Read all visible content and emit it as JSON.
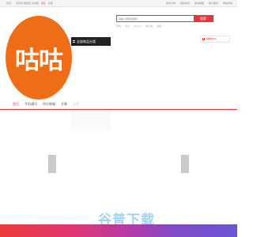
{
  "topbar": {
    "location": "送至：",
    "location_value": "北京市 朝阳区 东城区",
    "login": "您好",
    "register": "注册",
    "links": [
      "我的订单",
      "我的浏览",
      "我的收藏",
      "客户服务",
      "网站导航"
    ]
  },
  "logo": {
    "text": "咕咕",
    "color": "#ed6e17"
  },
  "category_button": {
    "label": "全部商品分类"
  },
  "search": {
    "placeholder": "请输入搜索关键字",
    "button_label": "搜索",
    "hotwords": [
      "手机",
      "牛奶",
      "iphone",
      "笔记本",
      "衣服"
    ]
  },
  "cart": {
    "label": "购物车(0)"
  },
  "nav": {
    "items": [
      {
        "label": "首页",
        "active": true
      },
      {
        "label": "手机通讯",
        "active": false
      },
      {
        "label": "积分商城",
        "active": false
      },
      {
        "label": "文章",
        "active": false
      },
      {
        "label": "品牌",
        "active": false
      }
    ]
  },
  "watermark": {
    "text": "谷普下载"
  },
  "colors": {
    "accent": "#e4393c",
    "logo": "#ed6e17"
  }
}
